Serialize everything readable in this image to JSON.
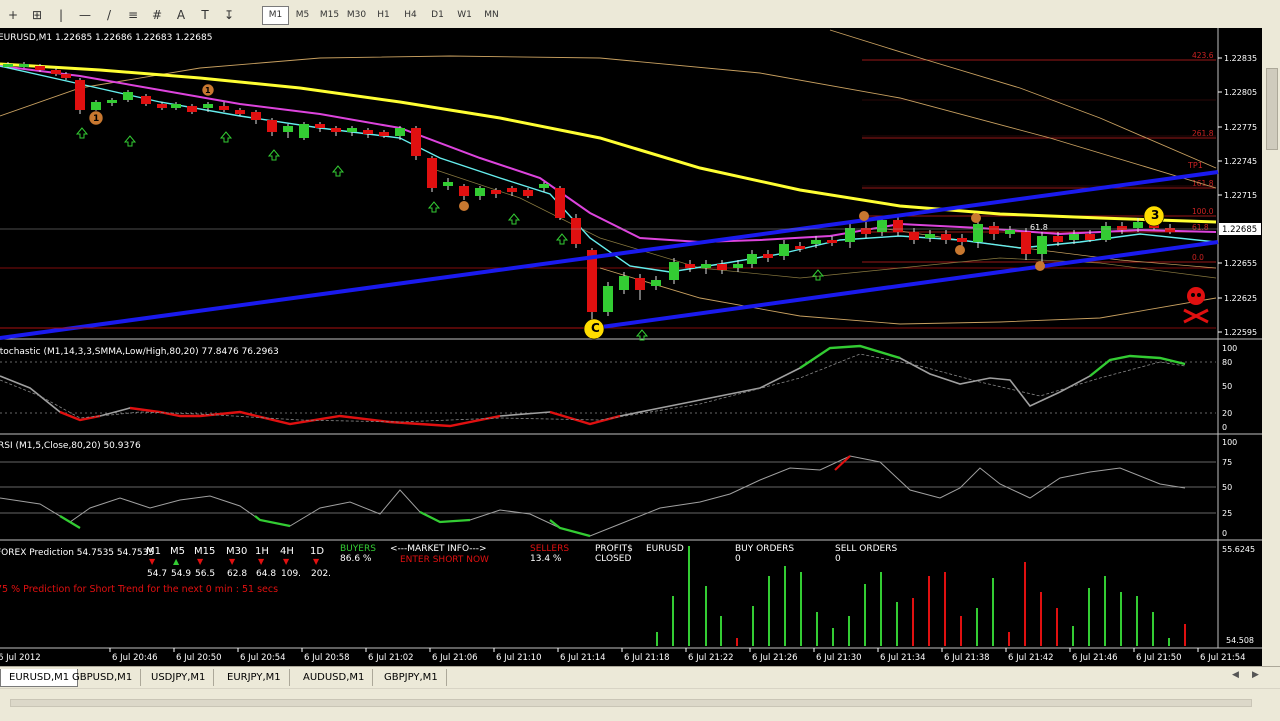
{
  "toolbar": {
    "tools": [
      "+",
      "⊞",
      "|",
      "—",
      "/",
      "≡",
      "#",
      "A",
      "T",
      "↧"
    ],
    "timeframes": [
      "M1",
      "M5",
      "M15",
      "M30",
      "H1",
      "H4",
      "D1",
      "W1",
      "MN"
    ],
    "active_timeframe": "M1"
  },
  "main": {
    "header": "EURUSD,M1  1.22685 1.22686 1.22683 1.22685",
    "price_labels": [
      "1.22835",
      "1.22805",
      "1.22775",
      "1.22745",
      "1.22715",
      "1.22685",
      "1.22655",
      "1.22625",
      "1.22595"
    ],
    "current_price": "1.22685",
    "fib_labels": [
      "423.6",
      "261.8",
      "161.8",
      "100.0",
      "61.8",
      "0.0"
    ],
    "fib_marker": "61.8",
    "tp_label": "TP1",
    "circle_markers": [
      "1",
      "1",
      "C",
      "3"
    ]
  },
  "stoch": {
    "header": "Stochastic (M1,14,3,3,SMMA,Low/High,80,20) 77.8476 76.2963",
    "scale": [
      "100",
      "80",
      "50",
      "20",
      "0"
    ]
  },
  "rsi": {
    "header": "RSI (M1,5,Close,80,20) 50.9376",
    "scale": [
      "100",
      "75",
      "50",
      "25",
      "0"
    ]
  },
  "forex": {
    "header": "FOREX Prediction  54.7535  54.7535",
    "tf_labels": [
      "M1",
      "M5",
      "M15",
      "M30",
      "1H",
      "4H",
      "1D"
    ],
    "tf_values": [
      "54.7",
      "54.9",
      "56.5",
      "62.8",
      "64.8",
      "109.",
      "202."
    ],
    "buyers_label": "BUYERS",
    "buyers_value": "86.6 %",
    "market_info": "<---MARKET INFO--->",
    "enter_short": "ENTER SHORT NOW",
    "sellers_label": "SELLERS",
    "sellers_value": "13.4 %",
    "profits_label": "PROFIT$",
    "closed_label": "CLOSED",
    "symbol": "EURUSD",
    "buy_orders_label": "BUY ORDERS",
    "buy_orders_value": "0",
    "sell_orders_label": "SELL ORDERS",
    "sell_orders_value": "0",
    "prediction_text": "75 % Prediction for Short Trend for the next 0 min : 51 secs",
    "scale_top": "55.6245",
    "scale_bottom": "54.508"
  },
  "time_labels": [
    "6 Jul 2012",
    "6 Jul 20:46",
    "6 Jul 20:50",
    "6 Jul 20:54",
    "6 Jul 20:58",
    "6 Jul 21:02",
    "6 Jul 21:06",
    "6 Jul 21:10",
    "6 Jul 21:14",
    "6 Jul 21:18",
    "6 Jul 21:22",
    "6 Jul 21:26",
    "6 Jul 21:30",
    "6 Jul 21:34",
    "6 Jul 21:38",
    "6 Jul 21:42",
    "6 Jul 21:46",
    "6 Jul 21:50",
    "6 Jul 21:54"
  ],
  "tabs": [
    "EURUSD,M1",
    "GBPUSD,M1",
    "USDJPY,M1",
    "EURJPY,M1",
    "AUDUSD,M1",
    "GBPJPY,M1"
  ],
  "active_tab": "EURUSD,M1",
  "colors": {
    "bull": "#33cc33",
    "bear": "#e01010",
    "ma_yellow": "#ffff33",
    "ma_magenta": "#dd44dd",
    "ma_cyan": "#66eeee",
    "channel": "#1a1aee",
    "fib": "#cc2222",
    "envelope": "#c8a060",
    "grid_text": "#ffffff"
  }
}
